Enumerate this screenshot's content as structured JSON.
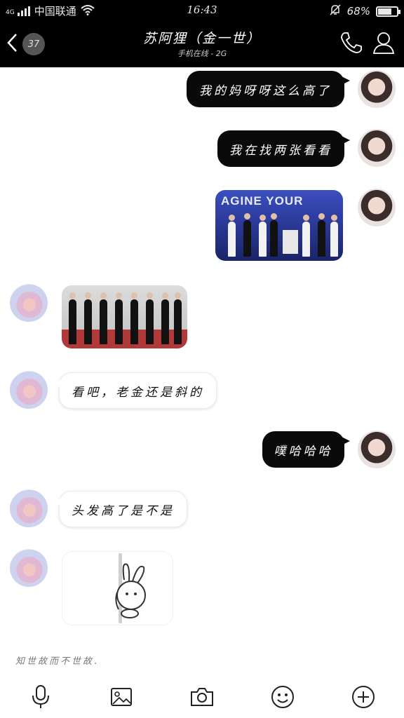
{
  "status_bar": {
    "network": "4G",
    "carrier": "中国联通",
    "time": "16:43",
    "battery_text": "68%",
    "battery_level": 0.68,
    "icons": [
      "signal-icon",
      "wifi-icon",
      "mute-bell-icon",
      "battery-icon"
    ]
  },
  "header": {
    "unread_count": "37",
    "contact_name": "苏阿狸（金一世）",
    "presence": "手机在线 - 2G",
    "icons": [
      "back-icon",
      "phone-icon",
      "profile-icon"
    ]
  },
  "messages": [
    {
      "direction": "out",
      "type": "text",
      "text": "我的妈呀呀这么高了"
    },
    {
      "direction": "out",
      "type": "text",
      "text": "我在找两张看看"
    },
    {
      "direction": "out",
      "type": "image",
      "image_text": "AGINE YOUR"
    },
    {
      "direction": "in",
      "type": "image"
    },
    {
      "direction": "in",
      "type": "text",
      "text": "看吧，老金还是斜的"
    },
    {
      "direction": "out",
      "type": "text",
      "text": "噗哈哈哈"
    },
    {
      "direction": "in",
      "type": "text",
      "text": "头发高了是不是"
    },
    {
      "direction": "in",
      "type": "sticker",
      "sticker": "rabbit-on-pole"
    }
  ],
  "input": {
    "hint": "知世故而不世故."
  },
  "toolbar": {
    "icons": [
      "microphone-icon",
      "image-icon",
      "camera-icon",
      "emoji-icon",
      "plus-icon"
    ]
  },
  "colors": {
    "bar_bg": "#000000",
    "outgoing_bubble": "#0a0a0a",
    "incoming_bubble": "#ffffff"
  }
}
